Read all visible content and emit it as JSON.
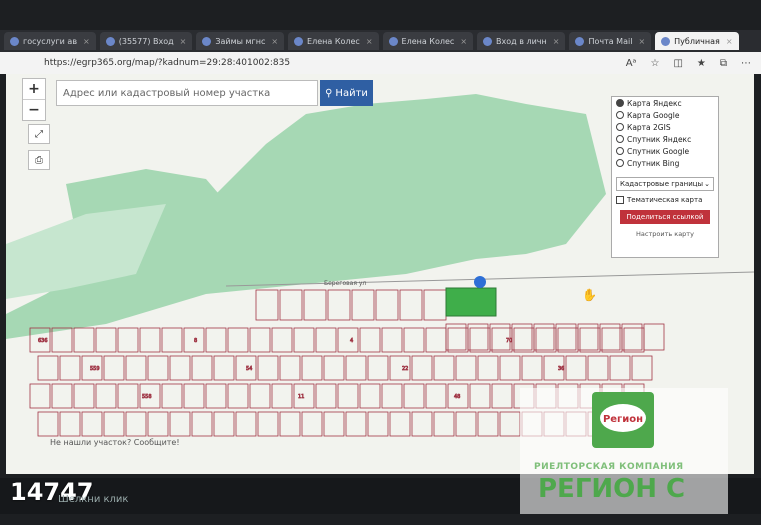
{
  "browser": {
    "tabs": [
      {
        "label": "госуслуги ав",
        "active": false
      },
      {
        "label": "(35577) Вход",
        "active": false
      },
      {
        "label": "Займы мгнс",
        "active": false
      },
      {
        "label": "Елена Колес",
        "active": false
      },
      {
        "label": "Елена Колес",
        "active": false
      },
      {
        "label": "Вход в личн",
        "active": false
      },
      {
        "label": "Почта Mail",
        "active": false
      },
      {
        "label": "Публичная",
        "active": true
      }
    ],
    "url": "https://egrp365.org/map/?kadnum=29:28:401002:835"
  },
  "search": {
    "placeholder": "Адрес или кадастровый номер участка",
    "button_label": "Найти"
  },
  "zoom": {
    "in": "+",
    "out": "−"
  },
  "layers": {
    "options": [
      {
        "label": "Карта Яндекс",
        "selected": true
      },
      {
        "label": "Карта Google",
        "selected": false
      },
      {
        "label": "Карта 2GIS",
        "selected": false
      },
      {
        "label": "Спутник Яндекс",
        "selected": false
      },
      {
        "label": "Спутник Google",
        "selected": false
      },
      {
        "label": "Спутник Bing",
        "selected": false
      }
    ],
    "select_value": "Кадастровые границы",
    "thematic_label": "Тематическая карта",
    "share_label": "Поделиться ссылкой",
    "configure_label": "Настроить карту"
  },
  "map": {
    "street": "Береговая ул",
    "parcels": [
      "636",
      "559",
      "558",
      "8",
      "54",
      "11",
      "4",
      "22",
      "48",
      "70",
      "36",
      "67"
    ],
    "not_found": "Не нашли участок? Сообщите!"
  },
  "watermark": {
    "company": "РИЕЛТОРСКАЯ КОМПАНИЯ",
    "name": "РЕГИОН С",
    "logo_text": "Регион"
  },
  "overlay": {
    "number": "14747",
    "click_text": "Шелкни клик"
  },
  "colors": {
    "selected_parcel": "#3fae4a",
    "forest": "#a6d8b4",
    "parcel_border": "#a03545"
  }
}
